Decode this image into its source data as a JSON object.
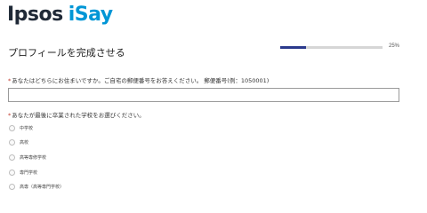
{
  "header": {
    "logo_main": "Ipsos",
    "logo_sub": "iSay"
  },
  "page_title": "プロフィールを完成させる",
  "progress": {
    "label": "25%",
    "value": 0.25
  },
  "questions": [
    {
      "required_marker": "*",
      "text": "あなたはどちらにお住まいですか。ご自宅の郵便番号をお答えください。 郵便番号(例：1050001)"
    },
    {
      "required_marker": "*",
      "text": "あなたが最後に卒業された学校をお選びください。",
      "options": [
        "中学校",
        "高校",
        "高等専修学校",
        "専門学校",
        "高専（高等専門学校）"
      ]
    }
  ],
  "colors": {
    "brand_blue": "#0096d6",
    "progress_fill": "#2b3a8c"
  }
}
